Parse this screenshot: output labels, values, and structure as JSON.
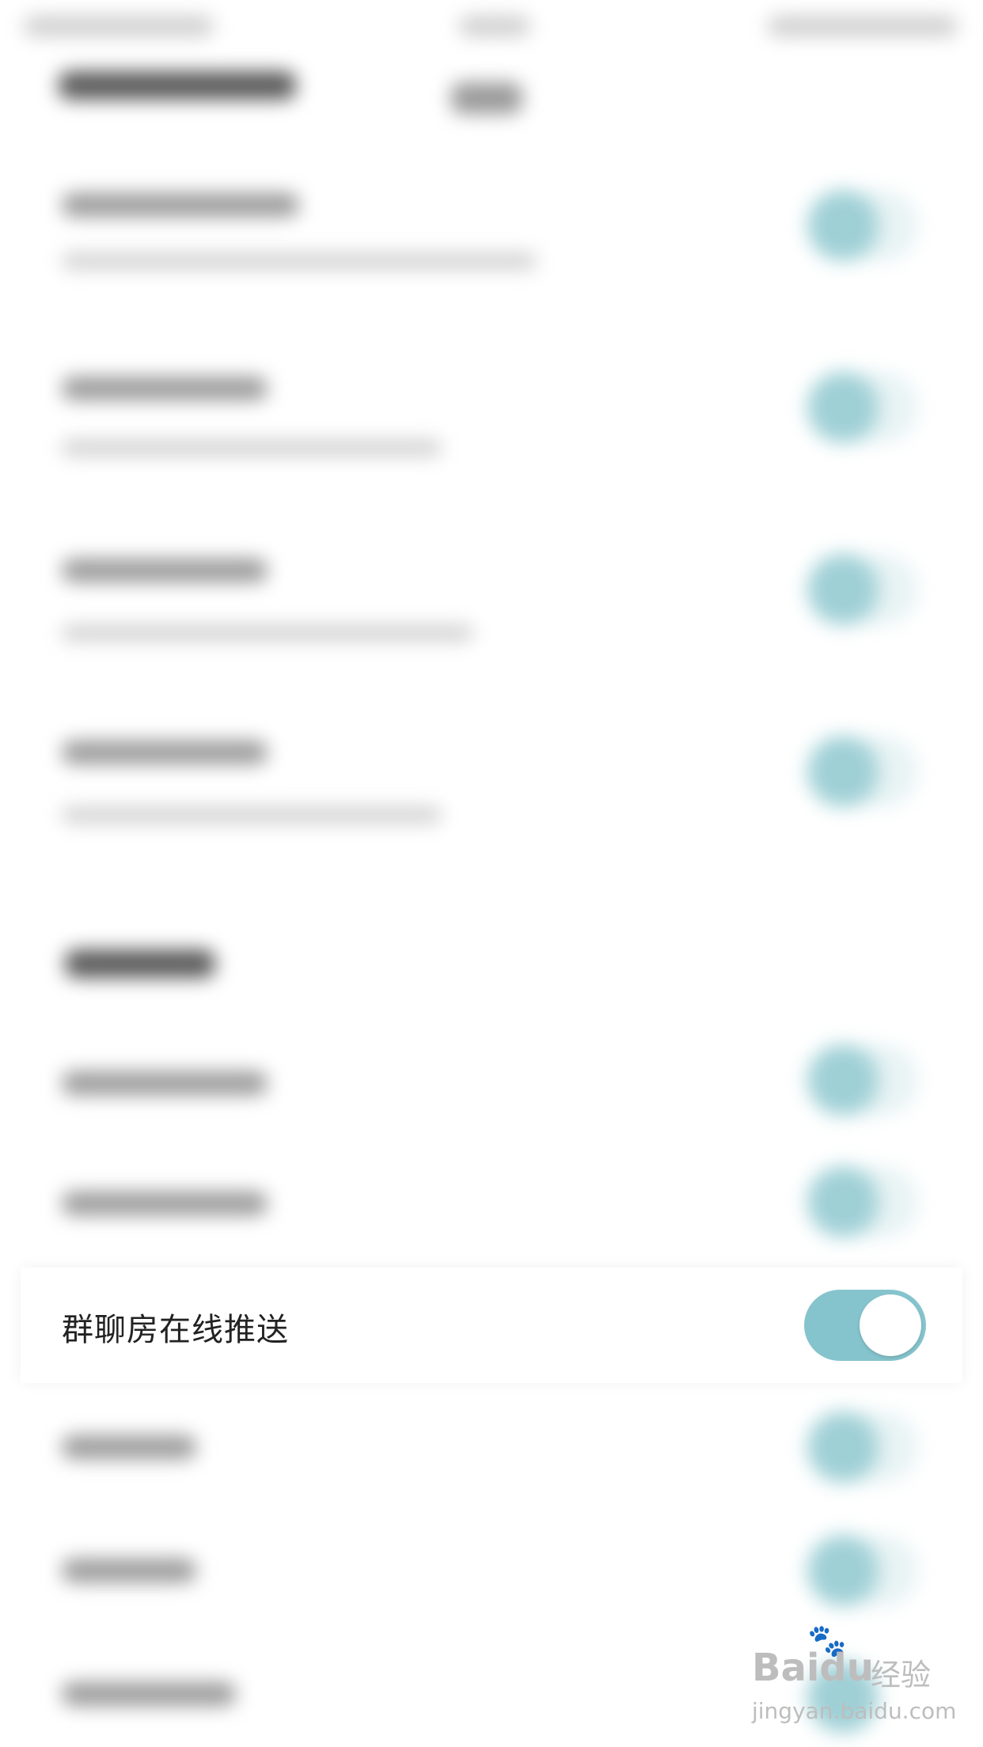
{
  "group_chat_push": {
    "label": "群聊房在线推送",
    "enabled": true,
    "accent_color": "#86c4cd"
  },
  "watermark": {
    "brand": "Baidu",
    "cn": "经验",
    "url": "jingyan.baidu.com"
  }
}
